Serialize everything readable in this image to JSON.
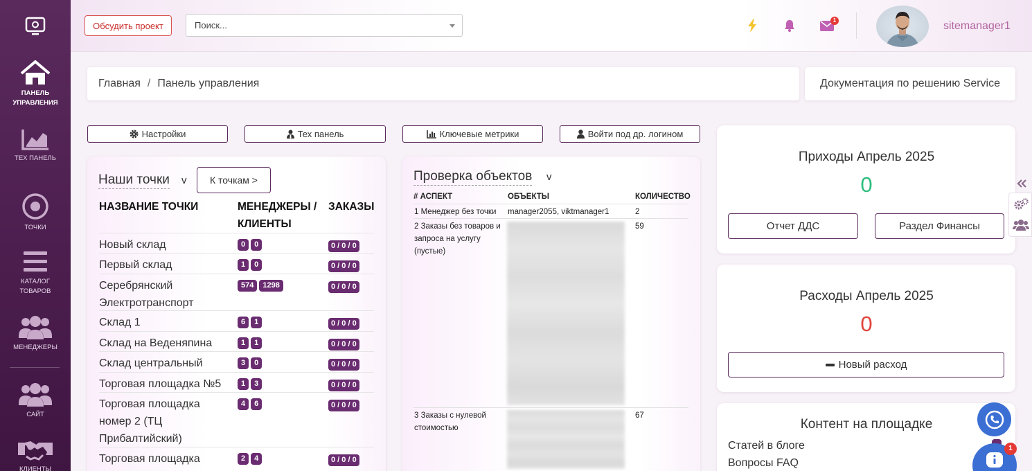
{
  "sidebar": {
    "items": [
      {
        "label_1": "ПАНЕЛЬ",
        "label_2": "УПРАВЛЕНИЯ"
      },
      {
        "label_1": "ТЕХ ПАНЕЛЬ",
        "label_2": ""
      },
      {
        "label_1": "ТОЧКИ",
        "label_2": ""
      },
      {
        "label_1": "КАТАЛОГ",
        "label_2": "ТОВАРОВ"
      },
      {
        "label_1": "МЕНЕДЖЕРЫ",
        "label_2": ""
      },
      {
        "label_1": "САЙТ",
        "label_2": ""
      },
      {
        "label_1": "КЛИЕНТЫ",
        "label_2": ""
      }
    ]
  },
  "topbar": {
    "discuss_button": "Обсудить проект",
    "search_placeholder": "Поиск...",
    "mail_badge": "1",
    "username": "sitemanager1"
  },
  "breadcrumb": {
    "home": "Главная",
    "separator": "/",
    "current": "Панель управления"
  },
  "doc_button": "Документация по решению Service",
  "toolbar": {
    "settings": "Настройки",
    "tech_panel": "Тех панель",
    "key_metrics": "Ключевые метрики",
    "login_as": "Войти под др. логином"
  },
  "points": {
    "title": "Наши точки",
    "caret": "v",
    "to_points_button": "К точкам >",
    "col_name": "НАЗВАНИЕ ТОЧКИ",
    "col_managers": "МЕНЕДЖЕРЫ /",
    "col_clients": "КЛИЕНТЫ",
    "col_orders": "ЗАКАЗЫ",
    "rows": [
      {
        "name": "Новый склад",
        "managers": "0",
        "clients": "0",
        "orders": "0 / 0 / 0"
      },
      {
        "name": "Первый склад",
        "managers": "1",
        "clients": "0",
        "orders": "0 / 0 / 0"
      },
      {
        "name": "Серебрянский Электротранспорт",
        "managers": "574",
        "clients": "1298",
        "orders": "0 / 0 / 0"
      },
      {
        "name": "Склад 1",
        "managers": "6",
        "clients": "1",
        "orders": "0 / 0 / 0"
      },
      {
        "name": "Склад на Веденяпина",
        "managers": "1",
        "clients": "1",
        "orders": "0 / 0 / 0"
      },
      {
        "name": "Склад центральный",
        "managers": "3",
        "clients": "0",
        "orders": "0 / 0 / 0"
      },
      {
        "name": "Торговая площадка №5",
        "managers": "1",
        "clients": "3",
        "orders": "0 / 0 / 0"
      },
      {
        "name": "Торговая площадка номер 2 (ТЦ Прибалтийский)",
        "managers": "4",
        "clients": "6",
        "orders": "0 / 0 / 0"
      },
      {
        "name": "Торговая площадка",
        "managers": "2",
        "clients": "4",
        "orders": "0 / 0 / 0"
      }
    ]
  },
  "check": {
    "title": "Проверка объектов",
    "caret": "v",
    "col_aspect": "# АСПЕКТ",
    "col_objects": "ОБЪЕКТЫ",
    "col_count": "КОЛИЧЕСТВО",
    "rows": [
      {
        "aspect": "1 Менеджер без точки",
        "objects": "manager2055, viktmanager1",
        "count": "2"
      },
      {
        "aspect": "2 Заказы без товаров и запроса на услугу (пустые)",
        "objects": "",
        "count": "59"
      },
      {
        "aspect": "3 Заказы с нулевой стоимостью",
        "objects": "",
        "count": "67"
      }
    ]
  },
  "income": {
    "title": "Приходы Апрель 2025",
    "value": "0",
    "value_color": "#2ebd7f",
    "dds_button": "Отчет ДДС",
    "finance_button": "Раздел Финансы"
  },
  "expenses": {
    "title": "Расходы Апрель 2025",
    "value": "0",
    "value_color": "#e0443a",
    "new_expense_button": "Новый расход"
  },
  "content": {
    "title": "Контент на площадке",
    "blog": "Статей в блоге",
    "faq": "Вопросы FAQ"
  },
  "chat": {
    "badge": "1"
  },
  "colors": {
    "sidebar": "#4d1f50",
    "accent": "#6a2c70",
    "username": "#b2659f",
    "lightning": "#f4c430",
    "bell": "#c05fb3",
    "mail": "#c05fb3"
  }
}
